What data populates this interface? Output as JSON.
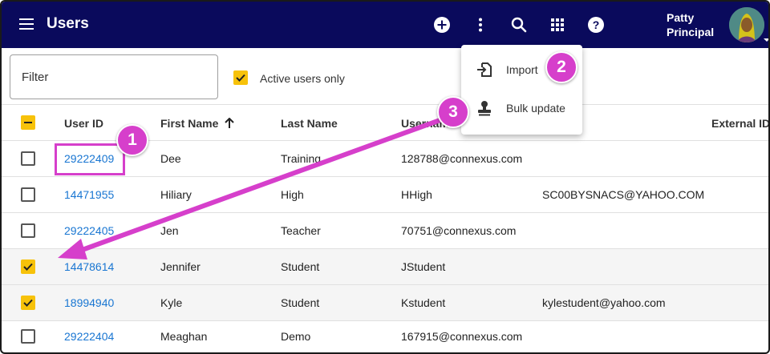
{
  "header": {
    "title": "Users",
    "user_name_first": "Patty",
    "user_name_last": "Principal",
    "background": "#0a0a5c"
  },
  "filter": {
    "placeholder": "Filter",
    "active_only_label": "Active users only",
    "active_only_checked": true
  },
  "menu": {
    "items": [
      {
        "label": "Import",
        "icon": "import-icon"
      },
      {
        "label": "Bulk update",
        "icon": "stamp-icon"
      }
    ]
  },
  "table": {
    "columns": [
      "User ID",
      "First Name",
      "Last Name",
      "Usernam",
      "External ID"
    ],
    "sort_indicator": "arrow-up-icon",
    "rows": [
      {
        "checked": false,
        "user_id": "29222409",
        "first": "Dee",
        "last": "Training",
        "username": "128788@connexus.com",
        "email": ""
      },
      {
        "checked": false,
        "user_id": "14471955",
        "first": "Hiliary",
        "last": "High",
        "username": "HHigh",
        "email": "SC00BYSNACS@YAHOO.COM"
      },
      {
        "checked": false,
        "user_id": "29222405",
        "first": "Jen",
        "last": "Teacher",
        "username": "70751@connexus.com",
        "email": ""
      },
      {
        "checked": true,
        "user_id": "14478614",
        "first": "Jennifer",
        "last": "Student",
        "username": "JStudent",
        "email": ""
      },
      {
        "checked": true,
        "user_id": "18994940",
        "first": "Kyle",
        "last": "Student",
        "username": "Kstudent",
        "email": "kylestudent@yahoo.com"
      },
      {
        "checked": false,
        "user_id": "29222404",
        "first": "Meaghan",
        "last": "Demo",
        "username": "167915@connexus.com",
        "email": ""
      }
    ]
  },
  "annotations": {
    "badges": [
      "1",
      "2",
      "3"
    ],
    "color": "#d63fcb"
  },
  "colors": {
    "accent": "#f7c20a",
    "link": "#1976d2"
  }
}
